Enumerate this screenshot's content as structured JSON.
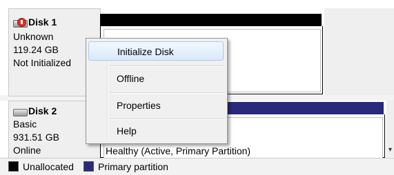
{
  "disks": [
    {
      "icon": "disk-warning-icon",
      "name": "Disk 1",
      "type": "Unknown",
      "size": "119.24 GB",
      "status": "Not Initialized"
    },
    {
      "icon": "disk-icon",
      "name": "Disk 2",
      "type": "Basic",
      "size": "931.51 GB",
      "status": "Online",
      "partition_status": "Healthy (Active, Primary Partition)"
    }
  ],
  "context_menu": {
    "items": [
      "Initialize Disk",
      "Offline",
      "Properties",
      "Help"
    ],
    "highlighted": "Initialize Disk"
  },
  "legend": [
    {
      "label": "Unallocated",
      "color": "#000000"
    },
    {
      "label": "Primary partition",
      "color": "#2a2a7c"
    }
  ]
}
